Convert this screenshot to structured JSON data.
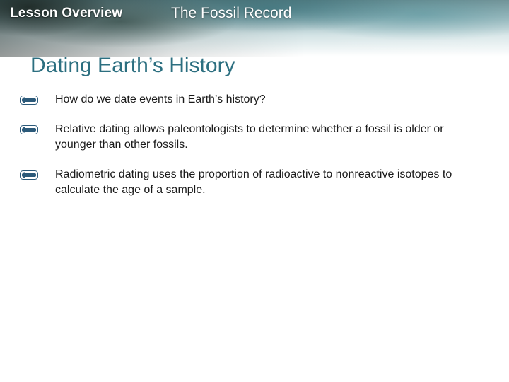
{
  "header": {
    "lesson_label": "Lesson Overview",
    "topic": "The Fossil Record"
  },
  "title": "Dating Earth’s History",
  "bullets": [
    {
      "text": "How do we date events in Earth’s history?",
      "icon": "key-bullet-icon"
    },
    {
      "text": "Relative dating allows paleontologists to determine whether a fossil is older or younger than other fossils.",
      "icon": "key-bullet-icon"
    },
    {
      "text": "Radiometric dating uses the proportion of radioactive to nonreactive isotopes to calculate the age of a sample.",
      "icon": "key-bullet-icon"
    }
  ],
  "colors": {
    "title": "#2c6f80",
    "bullet_icon": "#2c5a7a",
    "text": "#1a1a1a"
  }
}
